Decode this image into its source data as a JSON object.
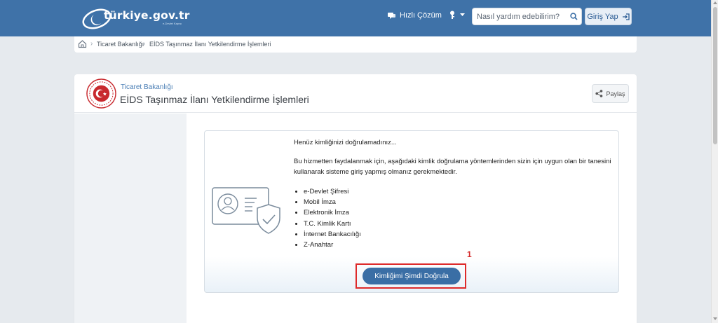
{
  "header": {
    "logo_text": "türkiye.gov.tr",
    "logo_sub": "e-Devlet Kapısı",
    "quick_solution": "Hızlı Çözüm",
    "search_placeholder": "Nasıl yardım edebilirim?",
    "login": "Giriş Yap"
  },
  "breadcrumb": {
    "items": [
      "Ticaret Bakanlığı",
      "EİDS Taşınmaz İlanı Yetkilendirme İşlemleri"
    ]
  },
  "service": {
    "ministry": "Ticaret Bakanlığı",
    "title": "EİDS Taşınmaz İlanı Yetkilendirme İşlemleri",
    "share": "Paylaş"
  },
  "auth": {
    "title": "Henüz kimliğinizi doğrulamadınız...",
    "body": "Bu hizmetten faydalanmak için, aşağıdaki kimlik doğrulama yöntemlerinden sizin için uygun olan bir tanesini kullanarak sisteme giriş yapmış olmanız gerekmektedir.",
    "methods": [
      "e-Devlet Şifresi",
      "Mobil İmza",
      "Elektronik İmza",
      "T.C. Kimlik Kartı",
      "İnternet Bankacılığı",
      "Z-Anahtar"
    ],
    "verify_button": "Kimliğimi Şimdi Doğrula"
  },
  "annotation": {
    "number": "1"
  },
  "colors": {
    "header_bg": "#3f72a8",
    "primary_button": "#3a6ea5",
    "annotation_red": "#de2a2a",
    "page_bg": "#e6eaee"
  },
  "icons": {
    "logo": "crescent-logo-icon",
    "quick": "chat-icon",
    "key": "key-icon",
    "search": "search-icon",
    "login": "sign-in-icon",
    "home": "home-icon",
    "share": "share-icon",
    "seal": "ministry-seal-icon",
    "idcard": "id-card-shield-icon"
  }
}
